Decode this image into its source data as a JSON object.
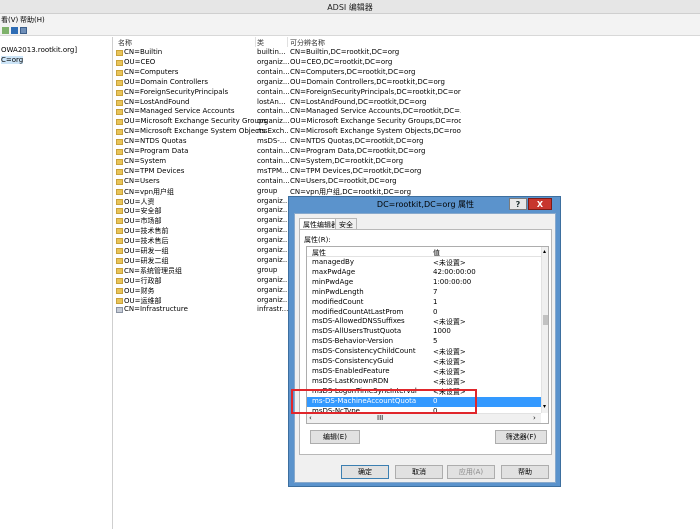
{
  "window": {
    "title": "ADSI 编辑器"
  },
  "menu": {
    "view": "看(V)",
    "help": "帮助(H)"
  },
  "tree": {
    "root": "OWA2013.rootkit.org]",
    "selected": "C=org"
  },
  "list": {
    "headers": [
      "名称",
      "类",
      "可分辨名称"
    ],
    "rows": [
      {
        "name": "CN=Builtin",
        "class": "builtin...",
        "dn": "CN=Builtin,DC=rootkit,DC=org",
        "icon": "folder-icon"
      },
      {
        "name": "OU=CEO",
        "class": "organiz...",
        "dn": "OU=CEO,DC=rootkit,DC=org",
        "icon": "folder-icon"
      },
      {
        "name": "CN=Computers",
        "class": "contain...",
        "dn": "CN=Computers,DC=rootkit,DC=org",
        "icon": "folder-icon"
      },
      {
        "name": "OU=Domain Controllers",
        "class": "organiz...",
        "dn": "OU=Domain Controllers,DC=rootkit,DC=org",
        "icon": "folder-icon"
      },
      {
        "name": "CN=ForeignSecurityPrincipals",
        "class": "contain...",
        "dn": "CN=ForeignSecurityPrincipals,DC=rootkit,DC=org",
        "icon": "folder-icon"
      },
      {
        "name": "CN=LostAndFound",
        "class": "lostAn...",
        "dn": "CN=LostAndFound,DC=rootkit,DC=org",
        "icon": "folder-icon"
      },
      {
        "name": "CN=Managed Service Accounts",
        "class": "contain...",
        "dn": "CN=Managed Service Accounts,DC=rootkit,DC=...",
        "icon": "folder-icon"
      },
      {
        "name": "OU=Microsoft Exchange Security Groups",
        "class": "organiz...",
        "dn": "OU=Microsoft Exchange Security Groups,DC=roo...",
        "icon": "folder-icon"
      },
      {
        "name": "CN=Microsoft Exchange System Objects",
        "class": "msExch...",
        "dn": "CN=Microsoft Exchange System Objects,DC=roo...",
        "icon": "folder-icon"
      },
      {
        "name": "CN=NTDS Quotas",
        "class": "msDS-...",
        "dn": "CN=NTDS Quotas,DC=rootkit,DC=org",
        "icon": "folder-icon"
      },
      {
        "name": "CN=Program Data",
        "class": "contain...",
        "dn": "CN=Program Data,DC=rootkit,DC=org",
        "icon": "folder-icon"
      },
      {
        "name": "CN=System",
        "class": "contain...",
        "dn": "CN=System,DC=rootkit,DC=org",
        "icon": "folder-icon"
      },
      {
        "name": "CN=TPM Devices",
        "class": "msTPM...",
        "dn": "CN=TPM Devices,DC=rootkit,DC=org",
        "icon": "folder-icon"
      },
      {
        "name": "CN=Users",
        "class": "contain...",
        "dn": "CN=Users,DC=rootkit,DC=org",
        "icon": "folder-icon"
      },
      {
        "name": "CN=vpn用户组",
        "class": "group",
        "dn": "CN=vpn用户组,DC=rootkit,DC=org",
        "icon": "folder-icon"
      },
      {
        "name": "OU=人资",
        "class": "organiz...",
        "dn": "",
        "icon": "folder-icon"
      },
      {
        "name": "OU=安全部",
        "class": "organiz...",
        "dn": "",
        "icon": "folder-icon"
      },
      {
        "name": "OU=市场部",
        "class": "organiz...",
        "dn": "",
        "icon": "folder-icon"
      },
      {
        "name": "OU=技术售前",
        "class": "organiz...",
        "dn": "",
        "icon": "folder-icon"
      },
      {
        "name": "OU=技术售后",
        "class": "organiz...",
        "dn": "",
        "icon": "folder-icon"
      },
      {
        "name": "OU=研发一组",
        "class": "organiz...",
        "dn": "",
        "icon": "folder-icon"
      },
      {
        "name": "OU=研发二组",
        "class": "organiz...",
        "dn": "",
        "icon": "folder-icon"
      },
      {
        "name": "CN=系统管理员组",
        "class": "group",
        "dn": "",
        "icon": "folder-icon"
      },
      {
        "name": "OU=行政部",
        "class": "organiz...",
        "dn": "",
        "icon": "folder-icon"
      },
      {
        "name": "OU=财务",
        "class": "organiz...",
        "dn": "",
        "icon": "folder-icon"
      },
      {
        "name": "OU=运维部",
        "class": "organiz...",
        "dn": "",
        "icon": "folder-icon"
      },
      {
        "name": "CN=Infrastructure",
        "class": "infrastr...",
        "dn": "",
        "icon": "infrastructure-icon"
      }
    ]
  },
  "dialog": {
    "title": "DC=rootkit,DC=org 属性",
    "help": "?",
    "close": "X",
    "tabs": [
      "属性编辑器",
      "安全"
    ],
    "attributes_label": "属性(R):",
    "grid_headers": [
      "属性",
      "值"
    ],
    "rows": [
      {
        "attr": "managedBy",
        "value": "<未设置>"
      },
      {
        "attr": "maxPwdAge",
        "value": "42:00:00:00"
      },
      {
        "attr": "minPwdAge",
        "value": "1:00:00:00"
      },
      {
        "attr": "minPwdLength",
        "value": "7"
      },
      {
        "attr": "modifiedCount",
        "value": "1"
      },
      {
        "attr": "modifiedCountAtLastProm",
        "value": "0"
      },
      {
        "attr": "msDS-AllowedDNSSuffixes",
        "value": "<未设置>"
      },
      {
        "attr": "msDS-AllUsersTrustQuota",
        "value": "1000"
      },
      {
        "attr": "msDS-Behavior-Version",
        "value": "5"
      },
      {
        "attr": "msDS-ConsistencyChildCount",
        "value": "<未设置>"
      },
      {
        "attr": "msDS-ConsistencyGuid",
        "value": "<未设置>"
      },
      {
        "attr": "msDS-EnabledFeature",
        "value": "<未设置>"
      },
      {
        "attr": "msDS-LastKnownRDN",
        "value": "<未设置>"
      },
      {
        "attr": "msDS-LogonTimeSyncInterval",
        "value": "<未设置>"
      },
      {
        "attr": "ms-DS-MachineAccountQuota",
        "value": "0",
        "selected": true
      },
      {
        "attr": "msDS-NcType",
        "value": "0"
      }
    ],
    "edit_button": "编辑(E)",
    "filter_button": "筛选器(F)",
    "ok": "确定",
    "cancel": "取消",
    "apply": "应用(A)",
    "help_button": "帮助",
    "scroll_mark": "III"
  },
  "colors": {
    "highlight": "#3399ff",
    "annotation": "#e0262b",
    "dialog_frame": "#5b93cc"
  }
}
